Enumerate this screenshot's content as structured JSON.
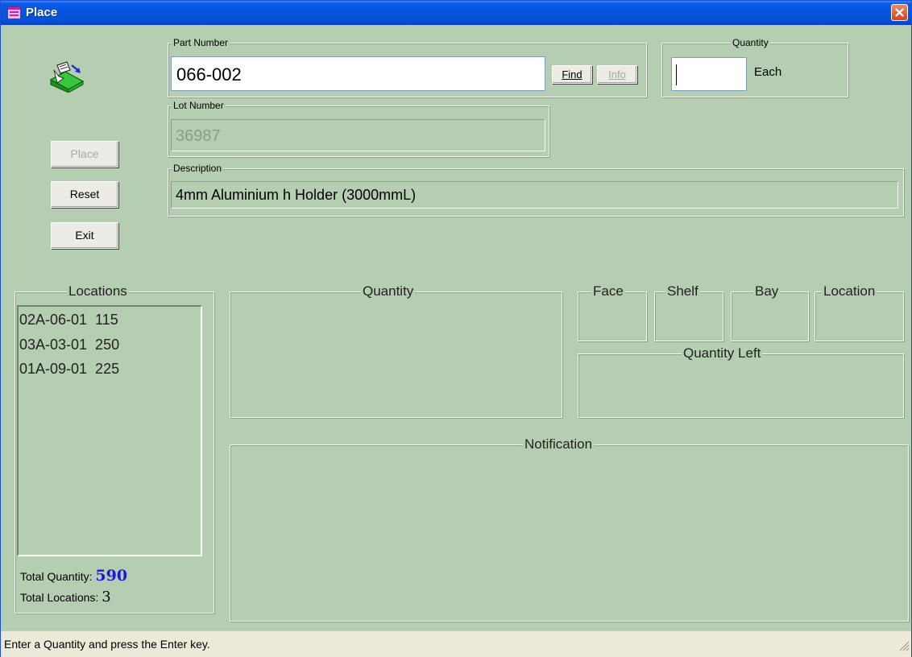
{
  "window": {
    "title": "Place"
  },
  "part": {
    "label": "Part Number",
    "value": "066-002",
    "find_label": "Find",
    "info_label": "Info"
  },
  "quantity_input": {
    "label": "Quantity",
    "value": "",
    "unit": "Each"
  },
  "lot": {
    "label": "Lot Number",
    "value": "36987"
  },
  "description": {
    "label": "Description",
    "value": "4mm Aluminium h Holder (3000mmL)"
  },
  "actions": {
    "place": "Place",
    "reset": "Reset",
    "exit": "Exit"
  },
  "locations": {
    "title": "Locations",
    "items": [
      "02A-06-01  115",
      "03A-03-01  250",
      "01A-09-01  225"
    ],
    "total_quantity_label": "Total Quantity:",
    "total_quantity": "590",
    "total_locations_label": "Total Locations:",
    "total_locations": "3"
  },
  "panels": {
    "quantity": "Quantity",
    "face": "Face",
    "shelf": "Shelf",
    "bay": "Bay",
    "location": "Location",
    "quantity_left": "Quantity Left",
    "notification": "Notification"
  },
  "status": {
    "text": "Enter a Quantity and press the Enter key."
  },
  "colors": {
    "background": "#b5cdb0",
    "titlebar": "#0654de",
    "total_quantity": "#1a1adb"
  },
  "icons": {
    "app": "app-window-icon",
    "place": "place-part-icon",
    "close": "close-icon",
    "grip": "resize-grip-icon"
  }
}
